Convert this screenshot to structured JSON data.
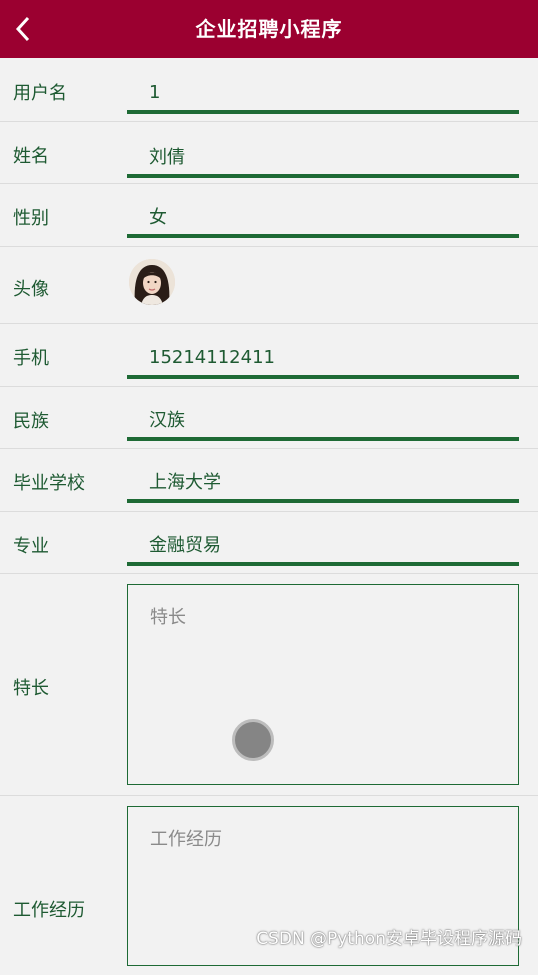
{
  "header": {
    "title": "企业招聘小程序",
    "back_icon": "chevron-left-icon"
  },
  "form": {
    "username": {
      "label": "用户名",
      "value": "1"
    },
    "name": {
      "label": "姓名",
      "value": "刘倩"
    },
    "gender": {
      "label": "性别",
      "value": "女"
    },
    "avatar": {
      "label": "头像"
    },
    "phone": {
      "label": "手机",
      "value": "15214112411"
    },
    "ethnicity": {
      "label": "民族",
      "value": "汉族"
    },
    "school": {
      "label": "毕业学校",
      "value": "上海大学"
    },
    "major": {
      "label": "专业",
      "value": "金融贸易"
    },
    "specialty": {
      "label": "特长",
      "placeholder": "特长"
    },
    "experience": {
      "label": "工作经历",
      "placeholder": "工作经历"
    }
  },
  "watermark": "CSDN @Python安卓毕设程序源码",
  "colors": {
    "header_bg": "#9b0030",
    "accent_green": "#1e6a35"
  }
}
